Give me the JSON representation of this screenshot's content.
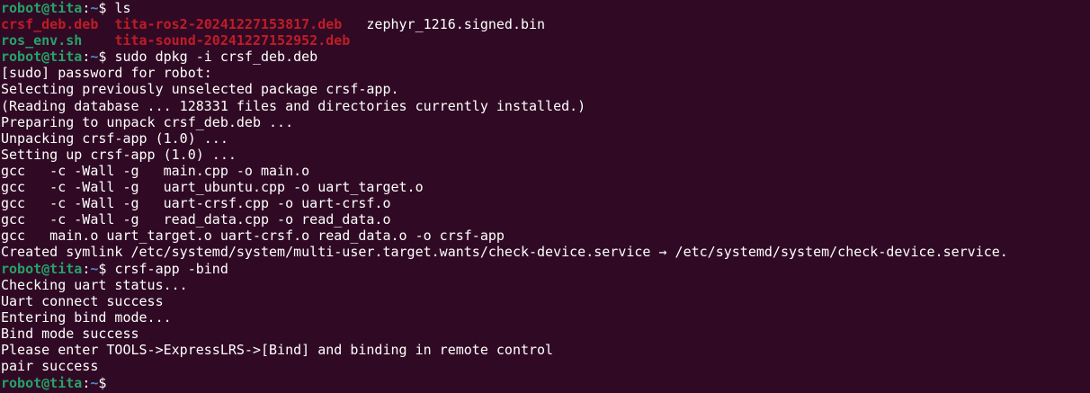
{
  "colors": {
    "background": "#300a24",
    "prompt_user": "#26a269",
    "prompt_path": "#4e8ad0",
    "deb_file": "#c01c28",
    "executable": "#26a269",
    "text": "#ffffff"
  },
  "prompt": {
    "user_host": "robot@tita",
    "separator": ":",
    "path": "~",
    "symbol": "$ "
  },
  "commands": {
    "ls": "ls",
    "dpkg": "sudo dpkg -i crsf_deb.deb",
    "bind": "crsf-app -bind"
  },
  "ls_output": {
    "row1": {
      "file1": "crsf_deb.deb",
      "file2": "tita-ros2-20241227153817.deb",
      "file3": "zephyr_1216.signed.bin"
    },
    "row2": {
      "file1": "ros_env.sh",
      "file2": "tita-sound-20241227152952.deb"
    }
  },
  "dpkg_output": [
    "[sudo] password for robot:",
    "Selecting previously unselected package crsf-app.",
    "(Reading database ... 128331 files and directories currently installed.)",
    "Preparing to unpack crsf_deb.deb ...",
    "Unpacking crsf-app (1.0) ...",
    "Setting up crsf-app (1.0) ...",
    "gcc   -c -Wall -g   main.cpp -o main.o",
    "gcc   -c -Wall -g   uart_ubuntu.cpp -o uart_target.o",
    "gcc   -c -Wall -g   uart-crsf.cpp -o uart-crsf.o",
    "gcc   -c -Wall -g   read_data.cpp -o read_data.o",
    "gcc   main.o uart_target.o uart-crsf.o read_data.o -o crsf-app",
    "Created symlink /etc/systemd/system/multi-user.target.wants/check-device.service → /etc/systemd/system/check-device.service."
  ],
  "bind_output": [
    "Checking uart status...",
    "Uart connect success",
    "Entering bind mode...",
    "Bind mode success",
    "Please enter TOOLS->ExpressLRS->[Bind] and binding in remote control",
    "pair success"
  ]
}
